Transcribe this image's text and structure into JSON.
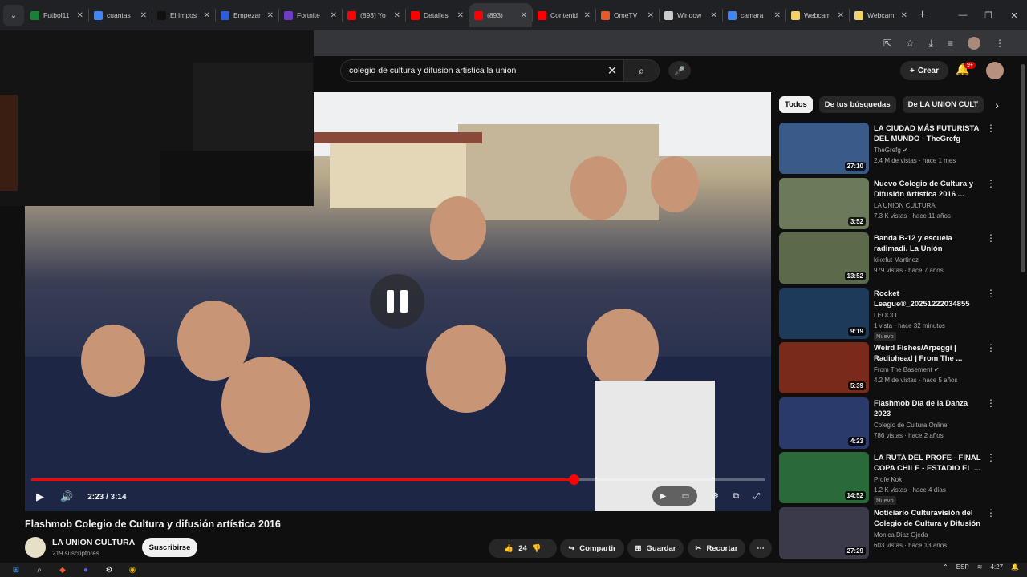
{
  "browser": {
    "tabs": [
      {
        "title": "Futbol11",
        "color": "#1a7f37"
      },
      {
        "title": "cuantas",
        "color": "#4285f4"
      },
      {
        "title": "El Impos",
        "color": "#111111"
      },
      {
        "title": "Empezar",
        "color": "#2b5fd9"
      },
      {
        "title": "Fortnite",
        "color": "#6f3cc4"
      },
      {
        "title": "(893) Yo",
        "color": "#ff0000"
      },
      {
        "title": "Detalles",
        "color": "#ff0000"
      },
      {
        "title": "(893)",
        "color": "#ff0000",
        "active": true
      },
      {
        "title": "Contenid",
        "color": "#ff0000"
      },
      {
        "title": "OmeTV",
        "color": "#e55a2b"
      },
      {
        "title": "Window",
        "color": "#cccccc"
      },
      {
        "title": "camara",
        "color": "#4285f4"
      },
      {
        "title": "Webcam",
        "color": "#f2d16b"
      },
      {
        "title": "Webcam",
        "color": "#f2d16b"
      }
    ]
  },
  "header": {
    "search_query": "colegio de cultura y difusion artistica la union",
    "create_label": "Crear",
    "notif_badge": "9+"
  },
  "player": {
    "time": "2:23 / 3:14",
    "progress": 0.74
  },
  "video": {
    "title": "Flashmob Colegio de Cultura y difusión artística 2016",
    "channel": "LA UNION CULTURA",
    "subscribers": "219 suscriptores",
    "subscribe_label": "Suscribirse",
    "likes": "24",
    "share_label": "Compartir",
    "save_label": "Guardar",
    "clip_label": "Recortar"
  },
  "chips": [
    "Todos",
    "De tus búsquedas",
    "De LA UNION CULT"
  ],
  "recommendations": [
    {
      "title": "LA CIUDAD MÁS FUTURISTA DEL MUNDO - TheGrefg",
      "channel": "TheGrefg",
      "meta": "2.4 M de vistas · hace 1 mes",
      "duration": "27:10",
      "thumb": "#3a5a8a",
      "verified": true
    },
    {
      "title": "Nuevo Colegio de Cultura y Difusión Artística 2016 ...",
      "channel": "LA UNION CULTURA",
      "meta": "7.3 K vistas · hace 11 años",
      "duration": "3:52",
      "thumb": "#6b7a5a"
    },
    {
      "title": "Banda B-12 y escuela radimadi. La Unión",
      "channel": "kikefut Martinez",
      "meta": "979 vistas · hace 7 años",
      "duration": "13:52",
      "thumb": "#5a6a4a"
    },
    {
      "title": "Rocket League®_20251222034855",
      "channel": "LEOOO",
      "meta": "1 vista · hace 32 minutos",
      "duration": "9:19",
      "thumb": "#1e3a5a",
      "badge": "Nuevo"
    },
    {
      "title": "Weird Fishes/Arpeggi | Radiohead | From The ...",
      "channel": "From The Basement",
      "meta": "4.2 M de vistas · hace 5 años",
      "duration": "5:39",
      "thumb": "#7a2a1a",
      "verified": true
    },
    {
      "title": "Flashmob Día de la Danza 2023",
      "channel": "Colegio de Cultura Online",
      "meta": "786 vistas · hace 2 años",
      "duration": "4:23",
      "thumb": "#2a3a6a"
    },
    {
      "title": "LA RUTA DEL PROFE - FINAL COPA CHILE - ESTADIO EL ...",
      "channel": "Profe Kok",
      "meta": "1.2 K vistas · hace 4 días",
      "duration": "14:52",
      "thumb": "#2a6a3a",
      "badge": "Nuevo"
    },
    {
      "title": "Noticiario Culturavisión del Colegio de Cultura y Difusión ...",
      "channel": "Monica Diaz Ojeda",
      "meta": "603 vistas · hace 13 años",
      "duration": "27:29",
      "thumb": "#3a3a4a"
    }
  ],
  "taskbar": {
    "lang": "ESP",
    "time": "4:27"
  }
}
